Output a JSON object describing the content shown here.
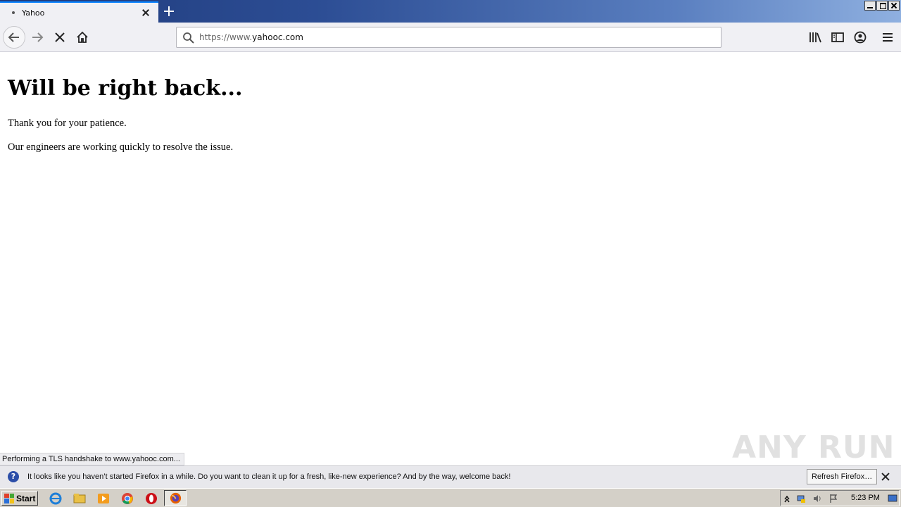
{
  "browser": {
    "tab_title": "Yahoo",
    "url_prefix": "https://www.",
    "url_domain": "yahooc.com"
  },
  "page": {
    "heading": "Will be right back...",
    "paragraph1": "Thank you for your patience.",
    "paragraph2": "Our engineers are working quickly to resolve the issue."
  },
  "status_text": "Performing a TLS handshake to www.yahooc.com...",
  "notification": {
    "message": "It looks like you haven’t started Firefox in a while. Do you want to clean it up for a fresh, like-new experience? And by the way, welcome back!",
    "refresh_label": "Refresh Firefox…"
  },
  "watermark": "ANY RUN",
  "taskbar": {
    "start_label": "Start",
    "clock": "5:23 PM"
  },
  "colors": {
    "accent": "#0a84ff",
    "titlebar_dark": "#1f3a7a",
    "titlebar_light": "#8fb0e0"
  }
}
